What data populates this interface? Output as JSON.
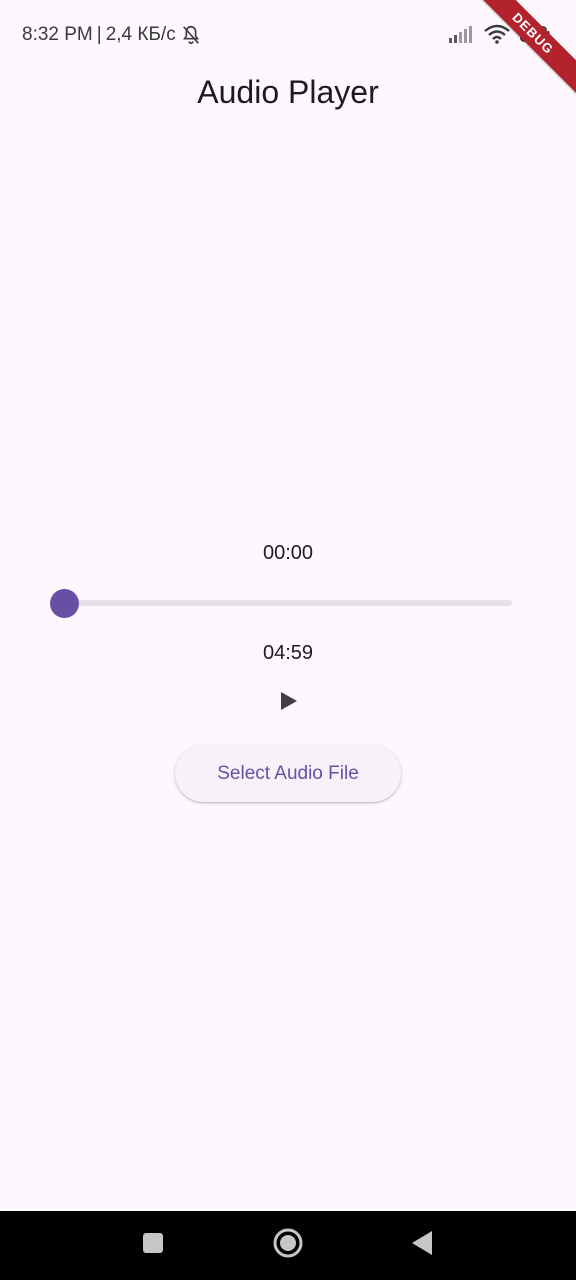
{
  "status_bar": {
    "time": "8:32 PM",
    "separator": "|",
    "network_speed": "2,4 КБ/с",
    "notification_icon": "bell-off-icon",
    "signal_icon": "signal-icon",
    "wifi_icon": "wifi-icon",
    "battery_icon": "battery-icon"
  },
  "debug_banner": {
    "label": "DEBUG"
  },
  "app_bar": {
    "title": "Audio Player"
  },
  "player": {
    "current_position": "00:00",
    "total_duration": "04:59",
    "progress_fraction": 0,
    "play_icon": "play-icon"
  },
  "actions": {
    "select_file_label": "Select Audio File"
  },
  "system_nav": {
    "recents_icon": "square-icon",
    "home_icon": "circle-icon",
    "back_icon": "triangle-back-icon"
  },
  "colors": {
    "background": "#fdf7fe",
    "accent": "#6750a4",
    "track": "#e6e0e9",
    "debug_banner": "#b3232e"
  }
}
